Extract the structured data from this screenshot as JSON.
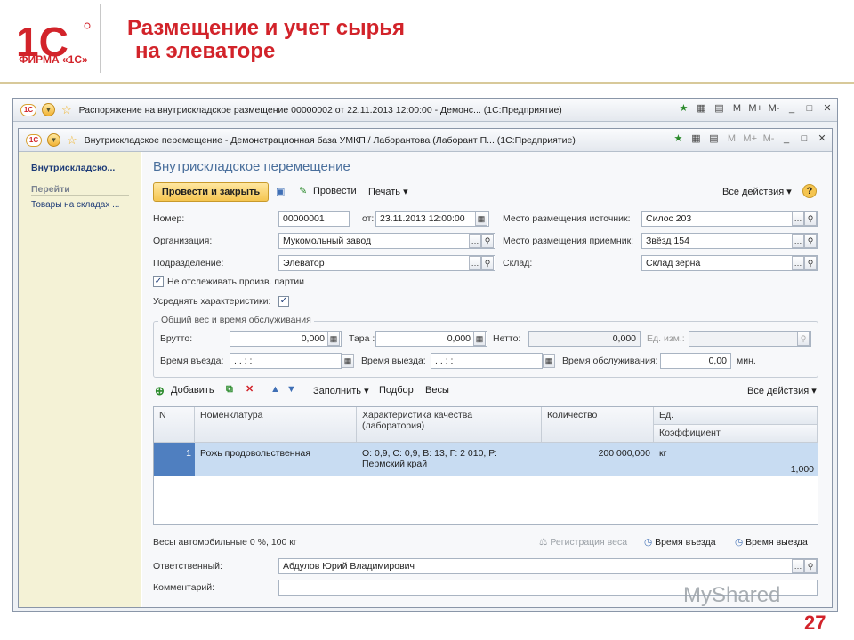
{
  "slide": {
    "logo_text": "ФИРМА «1С»",
    "title_line1": "Размещение и учет сырья",
    "title_line2": "на элеваторе",
    "page_number": "27",
    "watermark": "MyShared"
  },
  "outer_window": {
    "title": "Распоряжение на внутрискладское размещение 00000002 от 22.11.2013 12:00:00 - Демонс... (1С:Предприятие)",
    "buttons": [
      "M",
      "M+",
      "M-",
      "_",
      "□",
      "✕"
    ]
  },
  "inner_window": {
    "title": "Внутрискладское перемещение - Демонстрационная база УМКП / Лаборантова (Лаборант П... (1С:Предприятие)",
    "buttons": [
      "M",
      "M+",
      "M-",
      "_",
      "□",
      "✕"
    ]
  },
  "sidebar": {
    "heading": "Внутрискладско...",
    "section": "Перейти",
    "link": "Товары на складах ..."
  },
  "form": {
    "title": "Внутрискладское перемещение",
    "toolbar": {
      "post_close": "Провести и закрыть",
      "post": "Провести",
      "print": "Печать",
      "all_actions": "Все действия"
    },
    "fields": {
      "number_label": "Номер:",
      "number_value": "00000001",
      "date_label": "от:",
      "date_value": "23.11.2013 12:00:00",
      "org_label": "Организация:",
      "org_value": "Мукомольный завод",
      "dept_label": "Подразделение:",
      "dept_value": "Элеватор",
      "src_label": "Место размещения источник:",
      "src_value": "Силос 203",
      "dst_label": "Место размещения приемник:",
      "dst_value": "Звёзд 154",
      "warehouse_label": "Склад:",
      "warehouse_value": "Склад зерна",
      "no_track_label": "Не отслеживать произв. партии",
      "avg_label": "Усреднять характеристики:"
    },
    "weight_group": {
      "title": "Общий вес и время обслуживания",
      "gross_label": "Брутто:",
      "gross_value": "0,000",
      "tare_label": "Тара :",
      "tare_value": "0,000",
      "net_label": "Нетто:",
      "net_value": "0,000",
      "unit_label": "Ед. изм.:",
      "entry_label": "Время въезда:",
      "entry_value": " .  .    :  :",
      "exit_label": "Время выезда:",
      "exit_value": " .  .    :  :",
      "service_label": "Время обслуживания:",
      "service_value": "0,00",
      "service_unit": "мин."
    },
    "table_toolbar": {
      "add": "Добавить",
      "fill": "Заполнить",
      "selection": "Подбор",
      "weights": "Весы",
      "all_actions": "Все действия"
    },
    "table": {
      "headers": [
        "N",
        "Номенклатура",
        "Характеристика качества (лаборатория)",
        "Количество",
        "Ед.",
        "Коэффициент"
      ],
      "rows": [
        {
          "n": "1",
          "item": "Рожь продовольственная",
          "quality": "О: 0,9, С: 0,9, В: 13, Г: 2 010, Р: Пермский край",
          "qty": "200 000,000",
          "unit": "кг",
          "coef": "1,000"
        }
      ]
    },
    "bottom": {
      "scale_info": "Весы автомобильные 0 %, 100 кг",
      "reg_weight": "Регистрация веса",
      "entry_time": "Время въезда",
      "exit_time": "Время выезда",
      "resp_label": "Ответственный:",
      "resp_value": "Абдулов Юрий Владимирович",
      "comment_label": "Комментарий:",
      "comment_value": ""
    }
  }
}
